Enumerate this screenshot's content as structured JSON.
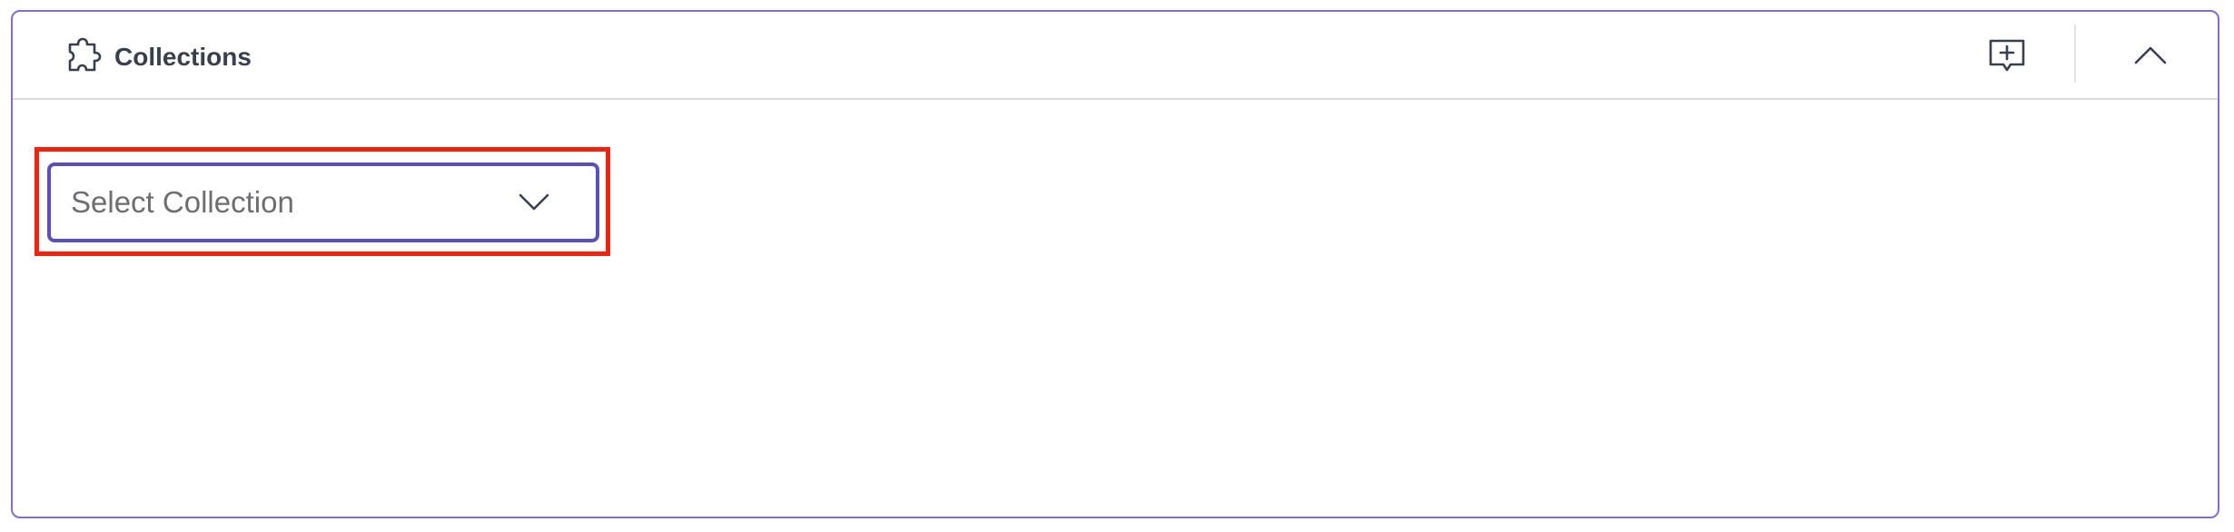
{
  "panel": {
    "title": "Collections",
    "icon": "puzzle-piece-icon",
    "actions": {
      "comment_icon": "comment-plus-icon",
      "collapse_icon": "chevron-up-icon"
    }
  },
  "collection_select": {
    "placeholder": "Select Collection",
    "icon": "chevron-down-icon"
  },
  "colors": {
    "panel_border": "#7b6ee0",
    "select_border": "#5b4fbb",
    "highlight": "#f0230f",
    "title_text": "#36404f"
  }
}
